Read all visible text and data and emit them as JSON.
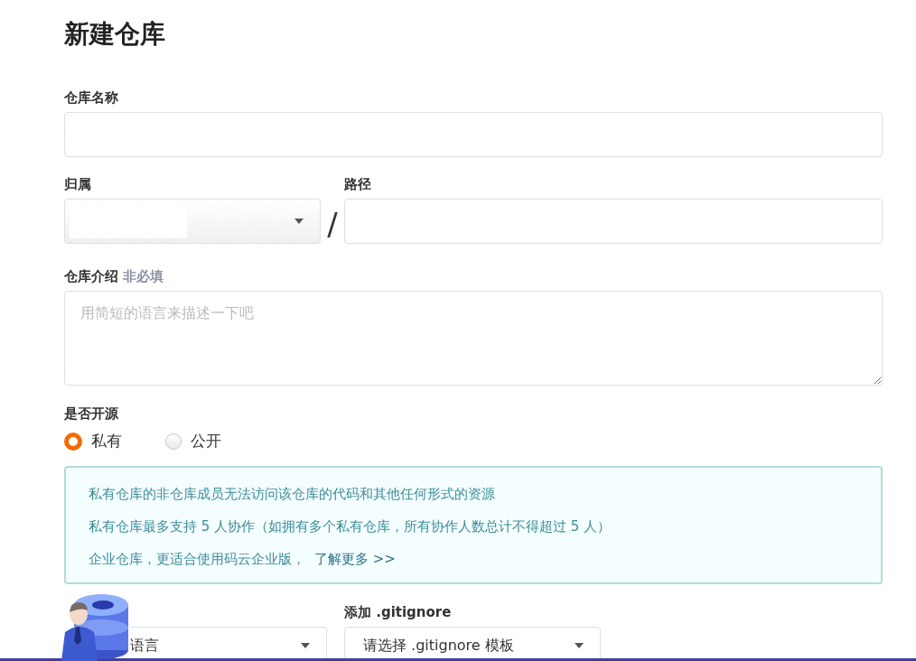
{
  "title": "新建仓库",
  "name_field": {
    "label": "仓库名称"
  },
  "owner": {
    "label": "归属"
  },
  "separator": "/",
  "path": {
    "label": "路径"
  },
  "description": {
    "label": "仓库介绍",
    "hint": "非必填",
    "placeholder": "用简短的语言来描述一下吧"
  },
  "visibility": {
    "label": "是否开源",
    "options": [
      {
        "label": "私有",
        "selected": true
      },
      {
        "label": "公开",
        "selected": false
      }
    ]
  },
  "notice": {
    "lines": [
      "私有仓库的非仓库成员无法访问该仓库的代码和其他任何形式的资源",
      "私有仓库最多支持 5 人协作（如拥有多个私有仓库，所有协作人数总计不得超过 5 人）",
      "企业仓库，更适合使用码云企业版，"
    ],
    "link": "了解更多 >>"
  },
  "language": {
    "placeholder": "语言"
  },
  "gitignore": {
    "label": "添加 .gitignore",
    "placeholder": "请选择 .gitignore 模板"
  }
}
